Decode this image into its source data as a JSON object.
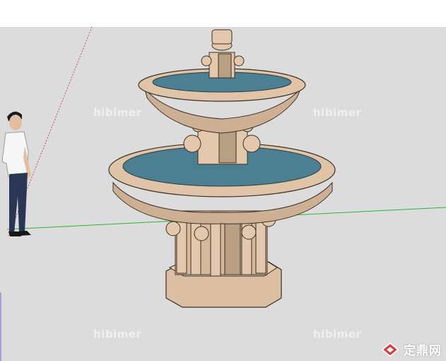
{
  "watermarks": [
    "hibimer",
    "hibimer",
    "hibimer",
    "hibimer"
  ],
  "brand": {
    "text": "定鼎网",
    "icon": "diamond-logo-icon"
  },
  "colors": {
    "viewport_bg": "#dcdcdc",
    "stone": "#dcbfa3",
    "water": "#4d7f92",
    "axis_green": "#2fb52f",
    "axis_red": "#d44a4a",
    "axis_blue": "#6d6dd9"
  }
}
